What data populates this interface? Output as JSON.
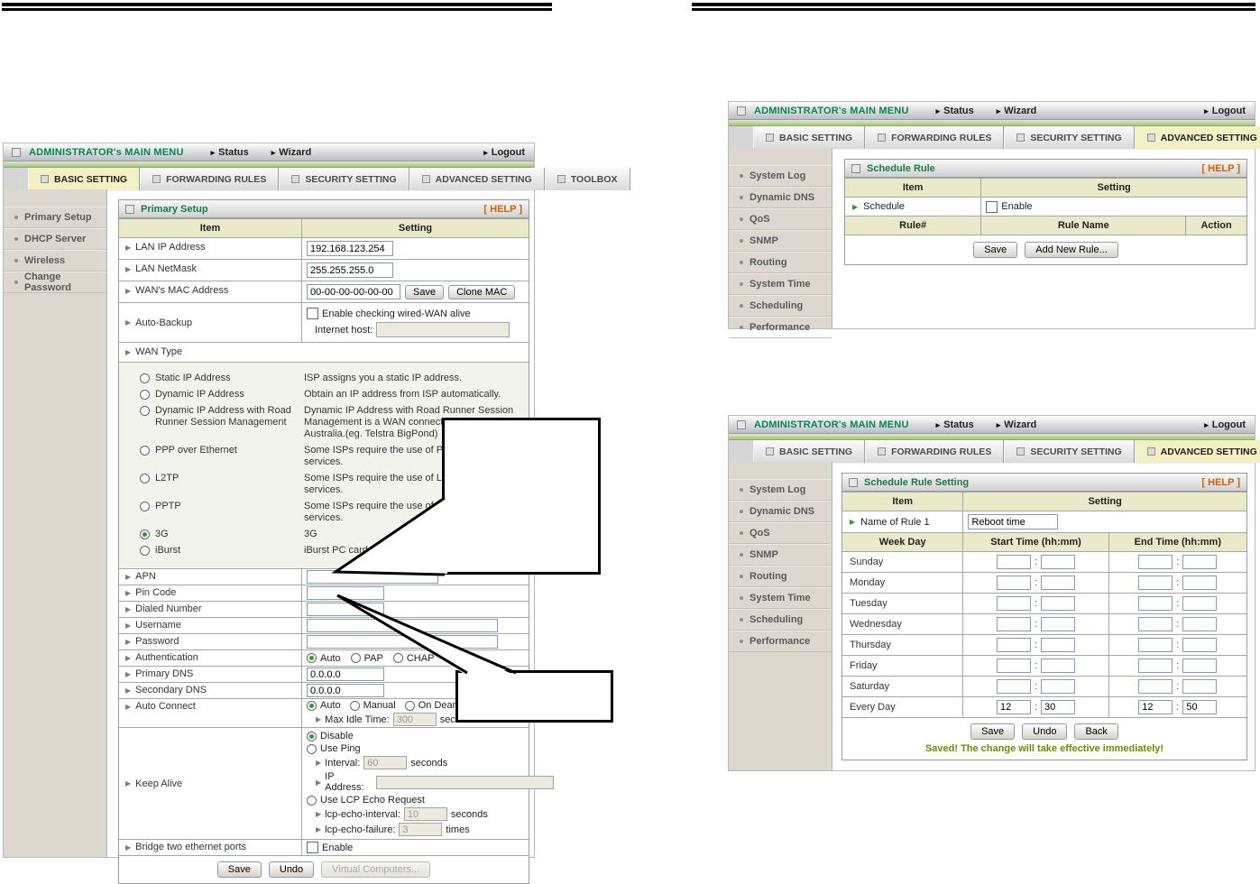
{
  "titlebar": {
    "title": "ADMINISTRATOR's MAIN MENU",
    "status": "Status",
    "wizard": "Wizard",
    "logout": "Logout"
  },
  "tabs": [
    "BASIC SETTING",
    "FORWARDING RULES",
    "SECURITY SETTING",
    "ADVANCED SETTING",
    "TOOLBOX"
  ],
  "left_sidebar": [
    "Primary Setup",
    "DHCP Server",
    "Wireless",
    "Change Password"
  ],
  "right_sidebar": [
    "System Log",
    "Dynamic DNS",
    "QoS",
    "SNMP",
    "Routing",
    "System Time",
    "Scheduling",
    "Performance"
  ],
  "primary_setup": {
    "title": "Primary Setup",
    "help": "[ HELP ]",
    "col_item": "Item",
    "col_setting": "Setting",
    "lan_ip": {
      "label": "LAN IP Address",
      "value": "192.168.123.254"
    },
    "lan_netmask": {
      "label": "LAN NetMask",
      "value": "255.255.255.0"
    },
    "wan_mac": {
      "label": "WAN's MAC Address",
      "value": "00-00-00-00-00-00",
      "save": "Save",
      "clone": "Clone MAC"
    },
    "auto_backup": {
      "label": "Auto-Backup",
      "enable": "Enable checking wired-WAN alive",
      "host": "Internet host:"
    },
    "wan_type_label": "WAN Type",
    "wan_options": [
      {
        "label": "Static IP Address",
        "desc": "ISP assigns you a static IP address."
      },
      {
        "label": "Dynamic IP Address",
        "desc": "Obtain an IP address from ISP automatically."
      },
      {
        "label": "Dynamic IP Address with Road Runner Session Management",
        "desc": "Dynamic IP Address with Road Runner Session\nManagement is a WAN connection us\nAustralia.(eg. Telstra BigPond)"
      },
      {
        "label": "PPP over Ethernet",
        "desc": "Some ISPs require the use of PPPoE\nservices."
      },
      {
        "label": "L2TP",
        "desc": "Some ISPs require the use of L2TP to\nservices."
      },
      {
        "label": "PPTP",
        "desc": "Some ISPs require the use of PPTP t\nservices."
      },
      {
        "label": "3G",
        "desc": "3G"
      },
      {
        "label": "iBurst",
        "desc": "iBurst PC card conn"
      }
    ],
    "apn": "APN",
    "pin": "Pin Code",
    "dialed": "Dialed Number",
    "username": "Username",
    "password": "Password",
    "auth": {
      "label": "Authentication",
      "auto": "Auto",
      "pap": "PAP",
      "chap": "CHAP"
    },
    "primary_dns": {
      "label": "Primary DNS",
      "value": "0.0.0.0"
    },
    "secondary_dns": {
      "label": "Secondary DNS",
      "value": "0.0.0.0"
    },
    "auto_connect": {
      "label": "Auto Connect",
      "auto": "Auto",
      "manual": "Manual",
      "on_demand": "On Deamnd",
      "idle": "Max Idle Time:",
      "idle_value": "300",
      "seconds": "seconds"
    },
    "keep_alive": {
      "label": "Keep Alive",
      "disable": "Disable",
      "use_ping": "Use Ping",
      "interval": "Interval:",
      "interval_value": "60",
      "seconds": "seconds",
      "ip": "IP Address:",
      "lcp": "Use LCP Echo Request",
      "lcp_interval": "lcp-echo-interval:",
      "lcp_interval_value": "10",
      "lcp_failure": "lcp-echo-failure:",
      "lcp_failure_value": "3",
      "times": "times"
    },
    "bridge": {
      "label": "Bridge two ethernet ports",
      "enable": "Enable"
    },
    "save": "Save",
    "undo": "Undo",
    "virtual": "Virtual Computers..."
  },
  "schedule_rule": {
    "title": "Schedule Rule",
    "help": "[ HELP ]",
    "col_item": "Item",
    "col_setting": "Setting",
    "schedule": "Schedule",
    "enable": "Enable",
    "rule_no": "Rule#",
    "rule_name": "Rule Name",
    "action": "Action",
    "save": "Save",
    "add": "Add New Rule..."
  },
  "schedule_setting": {
    "title": "Schedule Rule Setting",
    "help": "[ HELP ]",
    "col_item": "Item",
    "col_setting": "Setting",
    "name_label": "Name of Rule 1",
    "name_value": "Reboot time",
    "week_day": "Week Day",
    "start": "Start Time (hh:mm)",
    "end": "End Time (hh:mm)",
    "days": [
      "Sunday",
      "Monday",
      "Tuesday",
      "Wednesday",
      "Thursday",
      "Friday",
      "Saturday",
      "Every Day"
    ],
    "every": {
      "sh": "12",
      "sm": "30",
      "eh": "12",
      "em": "50"
    },
    "save": "Save",
    "undo": "Undo",
    "back": "Back",
    "status": "Saved! The change will take effective immediately!"
  }
}
